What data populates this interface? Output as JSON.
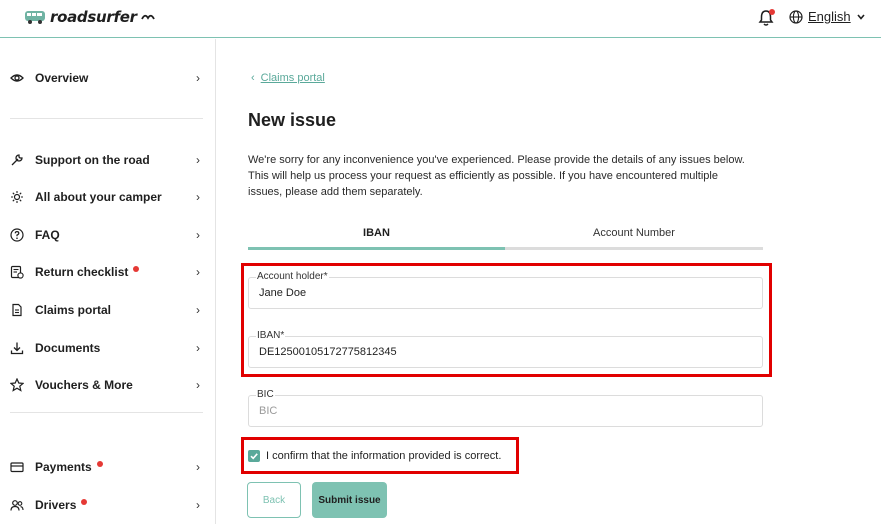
{
  "header": {
    "brand": "roadsurfer",
    "language": "English",
    "notification_badge": true
  },
  "sidebar": {
    "items": [
      {
        "label": "Overview",
        "icon": "eye-icon",
        "dot": false
      },
      {
        "label": "Support on the road",
        "icon": "wrench-icon",
        "dot": false
      },
      {
        "label": "All about your camper",
        "icon": "sun-icon",
        "dot": false
      },
      {
        "label": "FAQ",
        "icon": "question-icon",
        "dot": false
      },
      {
        "label": "Return checklist",
        "icon": "checklist-icon",
        "dot": true
      },
      {
        "label": "Claims portal",
        "icon": "document-icon",
        "dot": false
      },
      {
        "label": "Documents",
        "icon": "download-icon",
        "dot": false
      },
      {
        "label": "Vouchers & More",
        "icon": "star-icon",
        "dot": false
      },
      {
        "label": "Payments",
        "icon": "card-icon",
        "dot": true
      },
      {
        "label": "Drivers",
        "icon": "users-icon",
        "dot": true
      }
    ]
  },
  "main": {
    "breadcrumb": "Claims portal",
    "title": "New issue",
    "description": "We're sorry for any inconvenience you've experienced. Please provide the details of any issues below. This will help us process your request as efficiently as possible. If you have encountered multiple issues, please add them separately.",
    "tabs": [
      {
        "label": "IBAN",
        "active": true
      },
      {
        "label": "Account Number",
        "active": false
      }
    ],
    "fields": {
      "account_holder": {
        "label": "Account holder*",
        "value": "Jane Doe"
      },
      "iban": {
        "label": "IBAN*",
        "value": "DE12500105172775812345"
      },
      "bic": {
        "label": "BIC",
        "placeholder": "BIC",
        "value": ""
      }
    },
    "confirm_label": "I confirm that the information provided is correct.",
    "confirm_checked": true,
    "back_label": "Back",
    "submit_label": "Submit issue"
  },
  "colors": {
    "accent": "#7ec2b2",
    "accent_dark": "#5aa99a",
    "alert": "#e53935",
    "highlight": "#e10000"
  }
}
